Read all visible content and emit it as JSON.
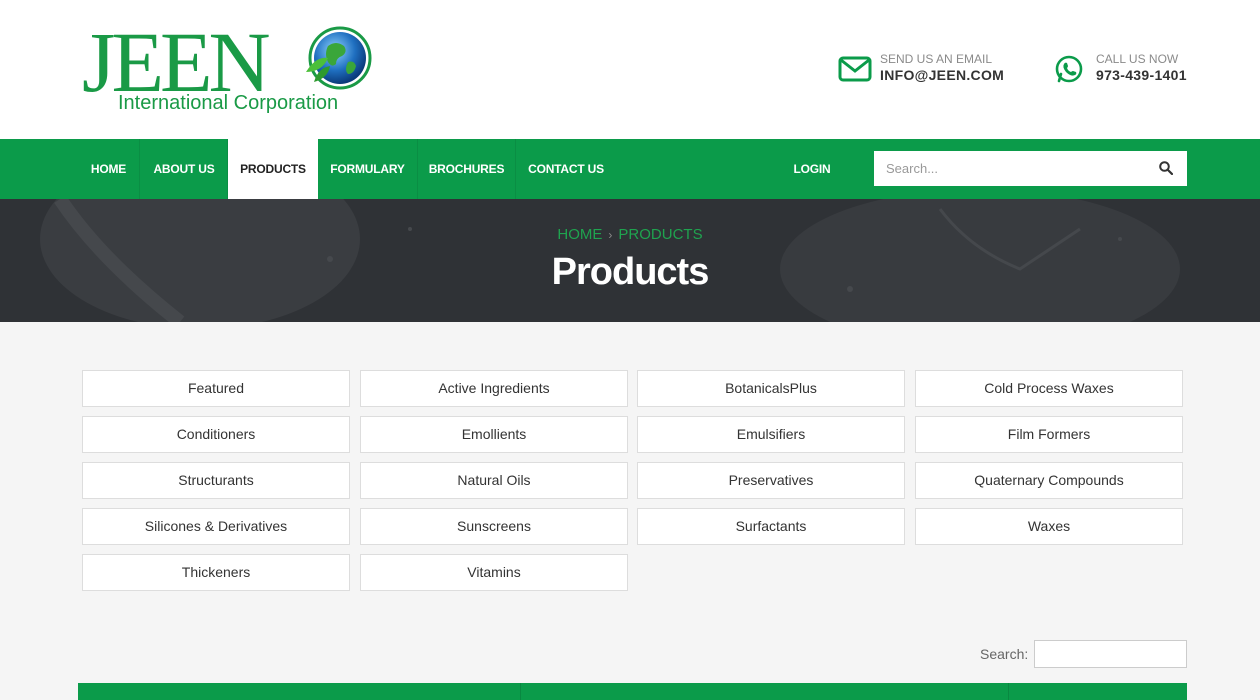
{
  "brand": {
    "logo_word": "JEEN",
    "logo_subtitle": "International Corporation"
  },
  "contacts": {
    "email_label": "SEND US AN EMAIL",
    "email_value": "INFO@JEEN.COM",
    "phone_label": "CALL US NOW",
    "phone_value": "973-439-1401"
  },
  "nav": {
    "items": [
      {
        "label": "HOME"
      },
      {
        "label": "ABOUT US"
      },
      {
        "label": "PRODUCTS"
      },
      {
        "label": "FORMULARY"
      },
      {
        "label": "BROCHURES"
      },
      {
        "label": "CONTACT US"
      }
    ],
    "login": "LOGIN",
    "search_placeholder": "Search...",
    "active_item": "PRODUCTS"
  },
  "hero": {
    "breadcrumb": [
      "HOME",
      "PRODUCTS"
    ],
    "title": "Products"
  },
  "categories": [
    "Featured",
    "Active Ingredients",
    "BotanicalsPlus",
    "Cold Process Waxes",
    "Conditioners",
    "Emollients",
    "Emulsifiers",
    "Film Formers",
    "Structurants",
    "Natural Oils",
    "Preservatives",
    "Quaternary Compounds",
    "Silicones & Derivatives",
    "Sunscreens",
    "Surfactants",
    "Waxes",
    "Thickeners",
    "Vitamins"
  ],
  "table": {
    "search_label": "Search:",
    "search_value": ""
  },
  "colors": {
    "brand_green": "#0b9b4a",
    "hero_dark": "#2f3236",
    "breadcrumb_green": "#1fa34f"
  },
  "icons": {
    "email": "envelope-icon",
    "phone": "whatsapp-phone-icon",
    "search": "search-icon"
  }
}
